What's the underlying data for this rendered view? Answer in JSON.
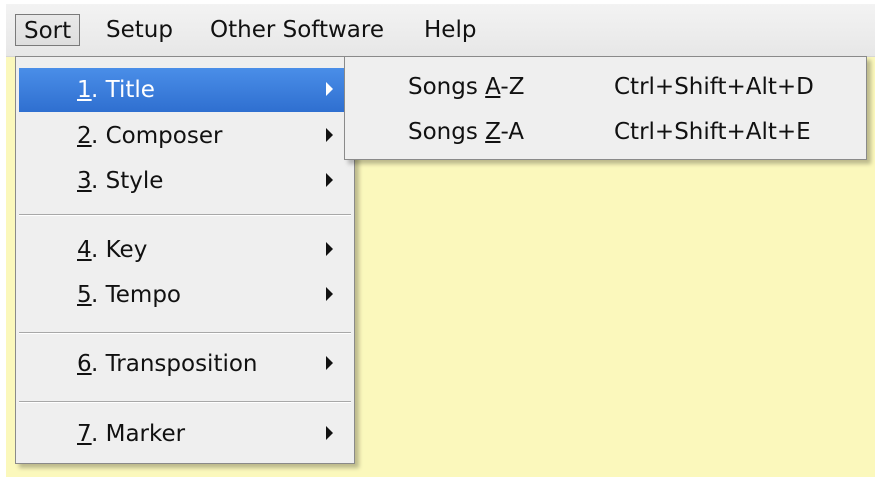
{
  "menubar": {
    "items": [
      {
        "label": "Sort"
      },
      {
        "label": "Setup"
      },
      {
        "label": "Other Software"
      },
      {
        "label": "Help"
      }
    ]
  },
  "sort_menu": {
    "items": [
      {
        "num": "1",
        "rest": ". Title"
      },
      {
        "num": "2",
        "rest": ". Composer"
      },
      {
        "num": "3",
        "rest": ". Style"
      },
      {
        "num": "4",
        "rest": ". Key"
      },
      {
        "num": "5",
        "rest": ". Tempo"
      },
      {
        "num": "6",
        "rest": ". Transposition"
      },
      {
        "num": "7",
        "rest": ". Marker"
      }
    ]
  },
  "title_submenu": {
    "items": [
      {
        "pre": "Songs ",
        "accel": "A",
        "post": "-Z",
        "shortcut": "Ctrl+Shift+Alt+D"
      },
      {
        "pre": "Songs ",
        "accel": "Z",
        "post": "-A",
        "shortcut": "Ctrl+Shift+Alt+E"
      }
    ]
  },
  "colors": {
    "workspace": "#fbf8bc",
    "highlight": "#3a7fdc",
    "menu_bg": "#efefef"
  }
}
